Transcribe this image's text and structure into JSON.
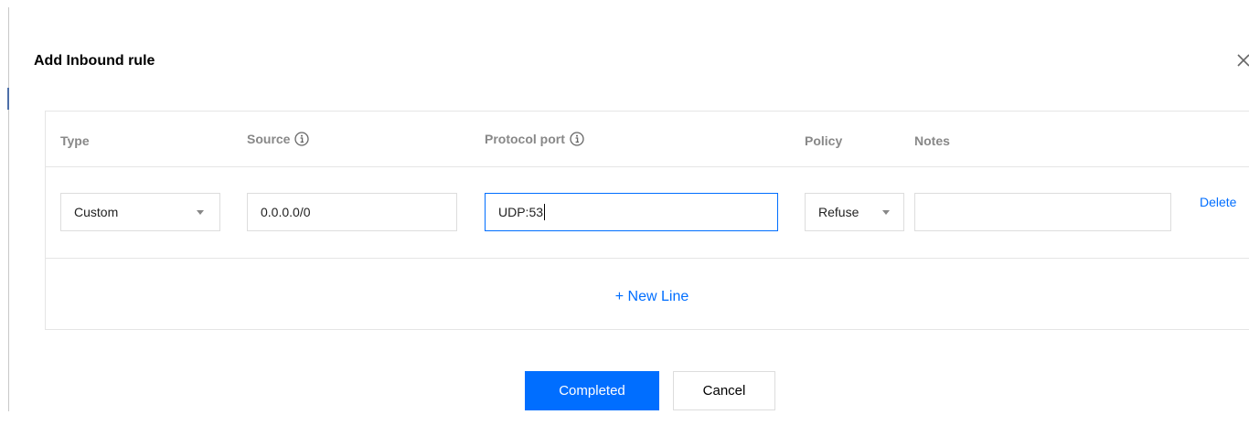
{
  "dialog": {
    "title": "Add Inbound rule"
  },
  "table": {
    "columns": {
      "type": "Type",
      "source": "Source",
      "protocol_port": "Protocol port",
      "policy": "Policy",
      "notes": "Notes"
    },
    "rows": [
      {
        "type": "Custom",
        "source": "0.0.0.0/0",
        "protocol_port": "UDP:53",
        "policy": "Refuse",
        "notes": "",
        "delete_label": "Delete"
      }
    ],
    "new_line_label": "+ New Line"
  },
  "buttons": {
    "completed": "Completed",
    "cancel": "Cancel"
  },
  "colors": {
    "accent": "#006eff",
    "header_text": "#888888",
    "border": "#e5e5e5"
  },
  "icons": {
    "close": "close-icon",
    "info": "info-icon",
    "dropdown": "chevron-down-icon"
  }
}
